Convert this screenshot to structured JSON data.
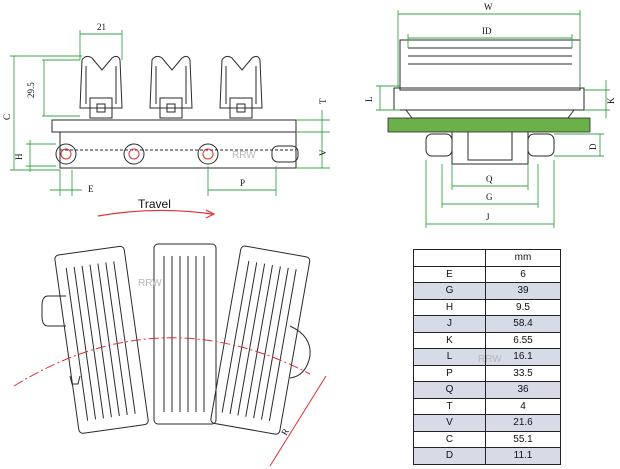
{
  "side_view": {
    "labels": {
      "top_width": "21",
      "height_1": "29.5",
      "c": "C",
      "t": "T",
      "v": "V",
      "h": "H",
      "e": "E",
      "p": "P"
    },
    "travel_label": "Travel",
    "watermark": "RRW"
  },
  "end_view": {
    "labels": {
      "w": "W",
      "id": "ID",
      "l": "L",
      "k": "K",
      "d": "D",
      "q": "Q",
      "g": "G",
      "j": "J"
    }
  },
  "top_view": {
    "r_label": "R",
    "watermark": "RRW"
  },
  "spec_table": {
    "header": [
      "",
      "mm"
    ],
    "rows": [
      {
        "dim": "E",
        "value": "6"
      },
      {
        "dim": "G",
        "value": "39"
      },
      {
        "dim": "H",
        "value": "9.5"
      },
      {
        "dim": "J",
        "value": "58.4"
      },
      {
        "dim": "K",
        "value": "6.55"
      },
      {
        "dim": "L",
        "value": "16.1"
      },
      {
        "dim": "P",
        "value": "33.5"
      },
      {
        "dim": "Q",
        "value": "36"
      },
      {
        "dim": "T",
        "value": "4"
      },
      {
        "dim": "V",
        "value": "21.6"
      },
      {
        "dim": "C",
        "value": "55.1"
      },
      {
        "dim": "D",
        "value": "11.1"
      }
    ],
    "watermark": "RRW"
  },
  "colors": {
    "dimension_line": "#3aa34a",
    "outline": "#2a2a2a",
    "arc": "#e23030",
    "plate_fill": "#6bb14a"
  }
}
